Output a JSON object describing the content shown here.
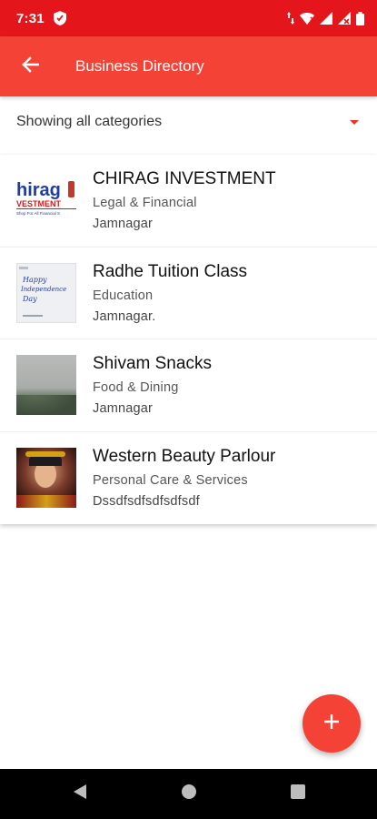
{
  "status_bar": {
    "time": "7:31"
  },
  "app_bar": {
    "title": "Business Directory"
  },
  "filter": {
    "selected_category": "Showing all categories"
  },
  "businesses": [
    {
      "name": "CHIRAG INVESTMENT",
      "category": "Legal & Financial",
      "city": "Jamnagar",
      "logo_text": "hirag",
      "logo_sub": "VESTMENT",
      "logo_tagline": "Shop For All Financial S"
    },
    {
      "name": "Radhe Tuition Class",
      "category": "Education",
      "city": "Jamnagar.",
      "thumb_line1": "Happy",
      "thumb_line2": "Independence",
      "thumb_line3": "Day"
    },
    {
      "name": "Shivam Snacks",
      "category": "Food & Dining",
      "city": "Jamnagar"
    },
    {
      "name": "Western Beauty Parlour",
      "category": "Personal Care & Services",
      "city": "Dssdfsdfsdfsdfsdf"
    }
  ],
  "colors": {
    "status_bar": "#e4151b",
    "app_bar": "#f44336",
    "accent": "#e8332c",
    "fab": "#f44336"
  },
  "icons": {
    "back": "arrow-left-icon",
    "dropdown": "dropdown-arrow-icon",
    "fab": "plus-icon",
    "nav_back": "triangle-back-icon",
    "nav_home": "circle-home-icon",
    "nav_recents": "square-recents-icon"
  }
}
